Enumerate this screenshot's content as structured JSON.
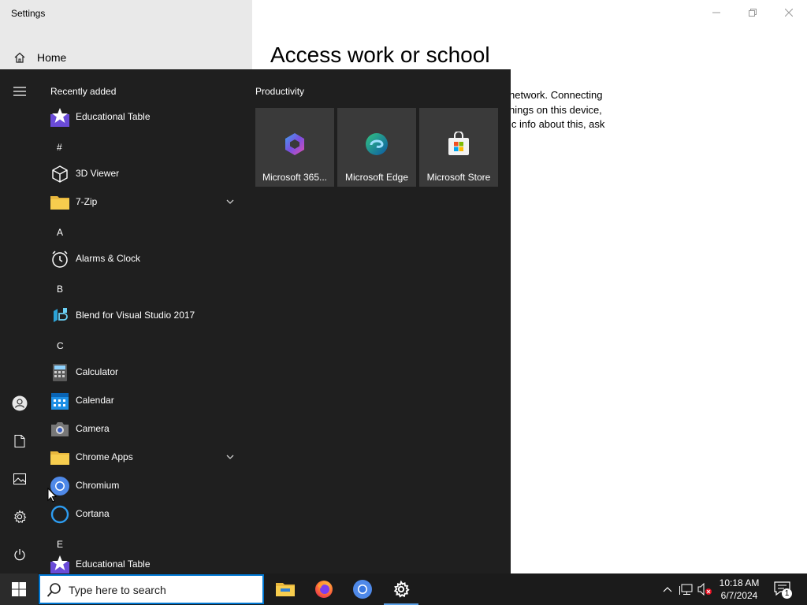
{
  "settings": {
    "window_title": "Settings",
    "home_label": "Home",
    "page_heading": "Access work or school",
    "description": "network. Connecting\nnings on this device,\nic info about this, ask"
  },
  "start_menu": {
    "recently_added_title": "Recently added",
    "group_title": "Productivity",
    "apps": [
      {
        "label": "Educational Table",
        "icon": "educational-table-icon"
      },
      {
        "letter": "#"
      },
      {
        "label": "3D Viewer",
        "icon": "3d-viewer-icon"
      },
      {
        "label": "7-Zip",
        "icon": "folder-icon",
        "expandable": true
      },
      {
        "letter": "A"
      },
      {
        "label": "Alarms & Clock",
        "icon": "alarms-clock-icon"
      },
      {
        "letter": "B"
      },
      {
        "label": "Blend for Visual Studio 2017",
        "icon": "blend-icon"
      },
      {
        "letter": "C"
      },
      {
        "label": "Calculator",
        "icon": "calculator-icon"
      },
      {
        "label": "Calendar",
        "icon": "calendar-icon"
      },
      {
        "label": "Camera",
        "icon": "camera-icon"
      },
      {
        "label": "Chrome Apps",
        "icon": "folder-icon",
        "expandable": true
      },
      {
        "label": "Chromium",
        "icon": "chromium-icon"
      },
      {
        "label": "Cortana",
        "icon": "cortana-icon"
      },
      {
        "letter": "E"
      },
      {
        "label": "Educational Table",
        "icon": "educational-table-icon"
      }
    ],
    "tiles": [
      {
        "label": "Microsoft 365...",
        "icon": "microsoft-365-icon"
      },
      {
        "label": "Microsoft Edge",
        "icon": "edge-icon"
      },
      {
        "label": "Microsoft Store",
        "icon": "store-icon"
      }
    ]
  },
  "taskbar": {
    "search_placeholder": "Type here to search",
    "time": "10:18 AM",
    "date": "6/7/2024",
    "notification_count": "1"
  }
}
